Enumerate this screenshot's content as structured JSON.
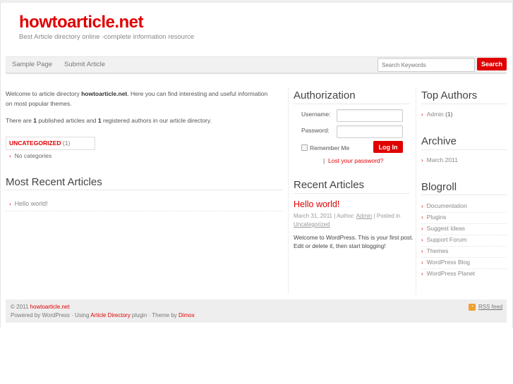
{
  "header": {
    "site_title": "howtoarticle.net",
    "tagline": "Best Article directory online -complete information resource"
  },
  "nav": {
    "items": [
      "Sample Page",
      "Submit Article"
    ],
    "search_placeholder": "Search Keywords",
    "search_button": "Search"
  },
  "intro": {
    "p1_a": "Welcome to article directory ",
    "p1_site": "howtoarticle.net",
    "p1_b": ". Here you can find interesting and useful information",
    "p1_c": "on most popular themes.",
    "p2_a": "There are ",
    "articles_count": "1",
    "p2_b": " published articles and ",
    "authors_count": "1",
    "p2_c": " registered authors in our article directory."
  },
  "category": {
    "name": "UNCATEGORIZED",
    "count": "(1)",
    "sub": "No categories"
  },
  "most_recent": {
    "heading": "Most Recent Articles",
    "items": [
      "Hello world!"
    ]
  },
  "auth": {
    "heading": "Authorization",
    "username_label": "Username:",
    "password_label": "Password:",
    "remember": "Remember Me",
    "login": "Log In",
    "sep": "|",
    "lost": "Lost your password?"
  },
  "recent": {
    "heading": "Recent Articles",
    "title": "Hello world!",
    "date": "March 31, 2011",
    "author_label": " | Author: ",
    "author": "Admin",
    "posted": " | Posted in",
    "category": "Uncategorized",
    "body1": "Welcome to WordPress. This is your first post.",
    "body2": "Edit or delete it, then start blogging!"
  },
  "top_authors": {
    "heading": "Top Authors",
    "items": [
      {
        "name": "Admin",
        "count": " (1)"
      }
    ]
  },
  "archive": {
    "heading": "Archive",
    "items": [
      "March 2011"
    ]
  },
  "blogroll": {
    "heading": "Blogroll",
    "items": [
      "Documentation",
      "Plugins",
      "Suggest Ideas",
      "Support Forum",
      "Themes",
      "WordPress Blog",
      "WordPress Planet"
    ]
  },
  "footer": {
    "copy": "© 2011 ",
    "site": "howtoarticle.net",
    "powered": "Powered by WordPress · Using ",
    "plugin": "Article Directory",
    "plugin_after": " plugin · Theme by ",
    "theme_author": "Dimox",
    "rss": "RSS feed"
  },
  "colors": {
    "accent": "#e00000"
  }
}
